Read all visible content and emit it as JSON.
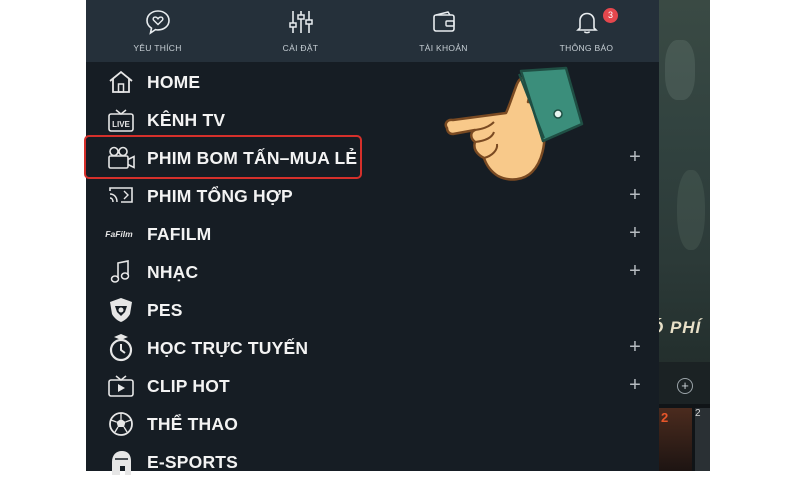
{
  "top_bar": {
    "items": [
      {
        "label": "YÊU THÍCH",
        "icon": "heart-chat-icon"
      },
      {
        "label": "CÀI ĐẶT",
        "icon": "sliders-icon"
      },
      {
        "label": "TÀI KHOẢN",
        "icon": "wallet-icon"
      },
      {
        "label": "THÔNG BÁO",
        "icon": "bell-icon",
        "badge": "3"
      }
    ]
  },
  "menu": {
    "items": [
      {
        "label": "HOME",
        "icon": "home-icon",
        "expandable": false
      },
      {
        "label": "KÊNH TV",
        "icon": "live-tv-icon",
        "icon_text": "LIVE",
        "expandable": false
      },
      {
        "label": "PHIM BOM TẤN–MUA LẺ",
        "icon": "movie-camera-icon",
        "expandable": true,
        "highlighted": true
      },
      {
        "label": "PHIM TỔNG HỢP",
        "icon": "cast-icon",
        "expandable": true
      },
      {
        "label": "FAFILM",
        "icon": "fafilm-logo-icon",
        "icon_text": "FaFilm",
        "expandable": true
      },
      {
        "label": "NHẠC",
        "icon": "music-note-icon",
        "expandable": true
      },
      {
        "label": "PES",
        "icon": "pes-shield-icon",
        "expandable": false
      },
      {
        "label": "HỌC TRỰC TUYẾN",
        "icon": "graduation-stopwatch-icon",
        "expandable": true
      },
      {
        "label": "CLIP HOT",
        "icon": "clip-tv-icon",
        "expandable": true
      },
      {
        "label": "THỂ THAO",
        "icon": "soccer-ball-icon",
        "expandable": false
      },
      {
        "label": "E-SPORTS",
        "icon": "spartan-helmet-icon",
        "expandable": false
      }
    ],
    "expand_symbol": "+"
  },
  "background": {
    "poster_text": "Ó PHÍ",
    "thumb_number": "2",
    "thumb2_text": "2"
  },
  "colors": {
    "drawer_bg": "#161d24",
    "top_bar_bg": "#25303a",
    "highlight_border": "#d5302b",
    "badge": "#e5474d"
  }
}
